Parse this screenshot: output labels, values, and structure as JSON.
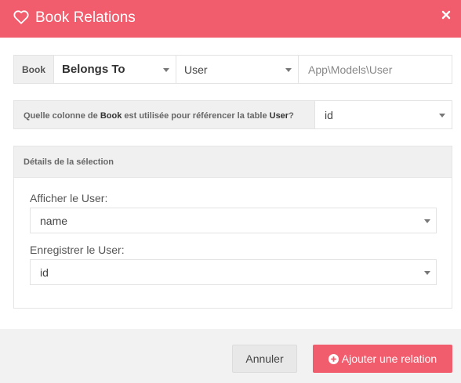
{
  "modal": {
    "title": "Book Relations",
    "icon": "heart-icon",
    "accent_color": "#f25d6d"
  },
  "relation": {
    "source_label": "Book",
    "type": "Belongs To",
    "related_model": "User",
    "related_model_path": "App\\Models\\User"
  },
  "foreign_key": {
    "question_prefix": "Quelle colonne de",
    "source": "Book",
    "question_middle": "est utilisée pour référencer la table",
    "target": "User",
    "question_suffix": "?",
    "value": "id"
  },
  "selection_details": {
    "heading": "Détails de la sélection",
    "display_label": "Afficher le User:",
    "display_value": "name",
    "store_label": "Enregistrer le User:",
    "store_value": "id"
  },
  "footer": {
    "cancel_label": "Annuler",
    "add_label": "Ajouter une relation"
  }
}
